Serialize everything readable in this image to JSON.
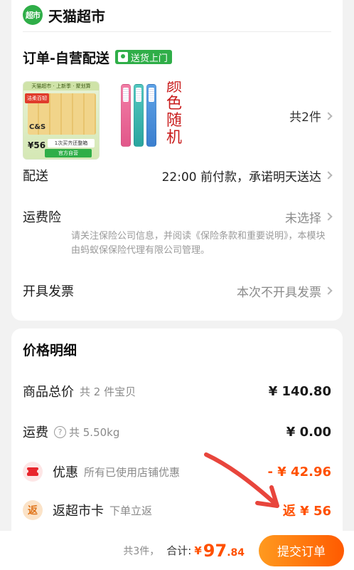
{
  "store": {
    "badge": "超市",
    "name": "天猫超市"
  },
  "order": {
    "title": "订单-自营配送",
    "delivery_tag": "送货上门"
  },
  "products": {
    "tissue": {
      "top_label": "天猫超市 · 上新季 · 聚划算",
      "promo": "洁柔百韧",
      "brand": "C&S",
      "price": "¥56",
      "note": "1次买齐还整箱",
      "footer": "官方自营"
    },
    "brush": {
      "caption": [
        "颜",
        "色",
        "随",
        "机"
      ]
    },
    "count": "共2件"
  },
  "delivery": {
    "label": "配送",
    "value": "22:00 前付款，承诺明天送达"
  },
  "insurance": {
    "label": "运费险",
    "value": "未选择",
    "note": "请关注保险公司信息，并阅读《保险条款和重要说明》，本模块由蚂蚁保保险代理有限公司管理。"
  },
  "invoice": {
    "label": "开具发票",
    "value": "本次不开具发票"
  },
  "price": {
    "title": "价格明细",
    "total": {
      "label": "商品总价",
      "sub": "共 2 件宝贝",
      "value": "¥ 140.80"
    },
    "shipping": {
      "label": "运费",
      "help_icon": "?",
      "sub": "共 5.50kg",
      "value": "¥ 0.00"
    },
    "discount": {
      "label": "优惠",
      "sub": "所有已使用店铺优惠",
      "value": "- ¥ 42.96"
    },
    "cashback": {
      "icon_text": "返",
      "label": "返超市卡",
      "sub": "下单立返",
      "value": "返 ¥ 56"
    }
  },
  "bottom": {
    "count": "共3件，",
    "total_label": "合计:",
    "yen": "¥",
    "total_int": "97",
    "total_dec": ".84",
    "submit": "提交订单"
  },
  "colors": {
    "brand_green": "#2fae48",
    "accent_orange": "#ff5000",
    "annotation_red": "#e8453c"
  }
}
